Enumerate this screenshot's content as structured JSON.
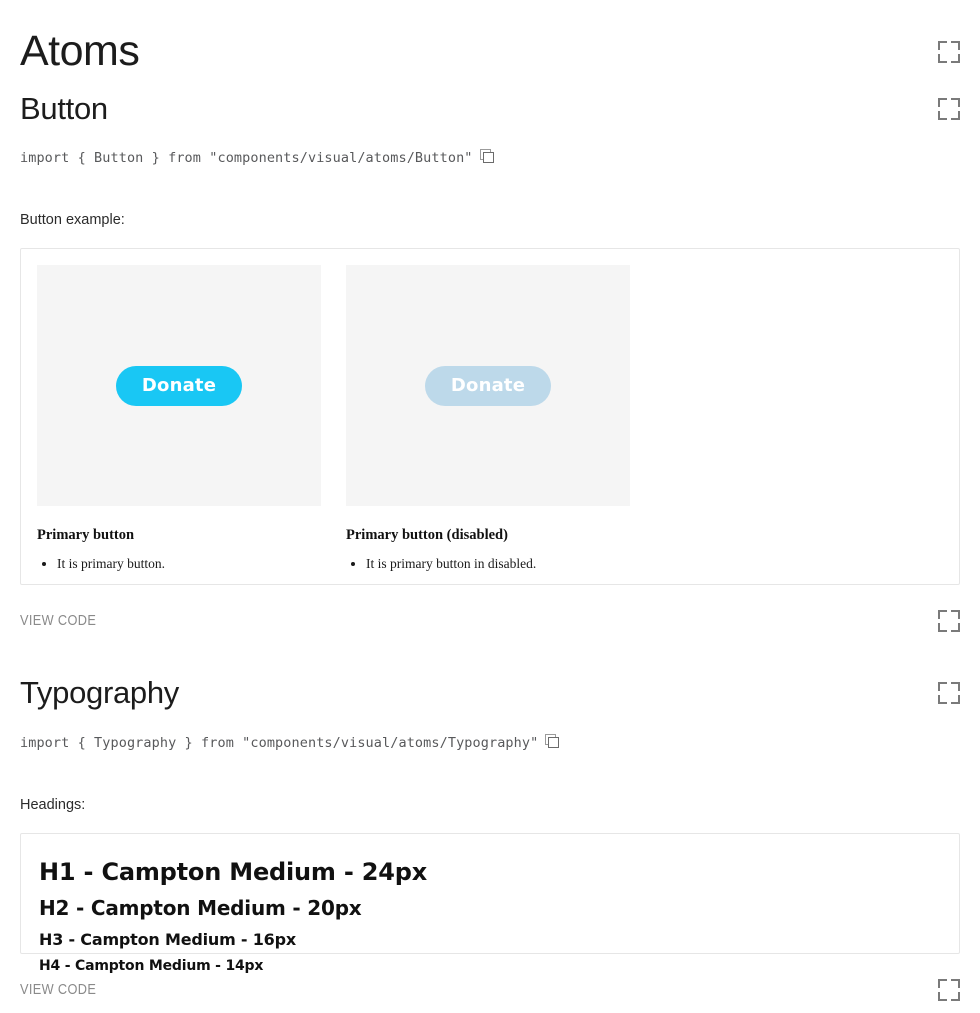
{
  "page": {
    "title": "Atoms"
  },
  "icons": {
    "expand": "expand-icon",
    "copy": "copy-icon"
  },
  "sections": [
    {
      "id": "button",
      "title": "Button",
      "import_statement": "import { Button } from \"components/visual/atoms/Button\"",
      "example_label": "Button example:",
      "view_code_label": "VIEW CODE",
      "demos": [
        {
          "button_label": "Donate",
          "state": "primary",
          "title": "Primary button",
          "bullets": [
            "It is primary button."
          ]
        },
        {
          "button_label": "Donate",
          "state": "disabled",
          "title": "Primary button (disabled)",
          "bullets": [
            "It is primary button in disabled."
          ]
        }
      ]
    },
    {
      "id": "typography",
      "title": "Typography",
      "import_statement": "import { Typography } from \"components/visual/atoms/Typography\"",
      "example_label": "Headings:",
      "view_code_label": "VIEW CODE",
      "headings": [
        "H1 - Campton Medium - 24px",
        "H2 - Campton Medium - 20px",
        "H3 - Campton Medium - 16px",
        "H4 - Campton Medium - 14px"
      ]
    }
  ],
  "colors": {
    "primary_button": "#19c7f4",
    "disabled_button": "#bdd9ea",
    "demo_stage_bg": "#f5f5f5",
    "card_border": "#e6e6e6",
    "muted_text": "#8a8a8a"
  }
}
